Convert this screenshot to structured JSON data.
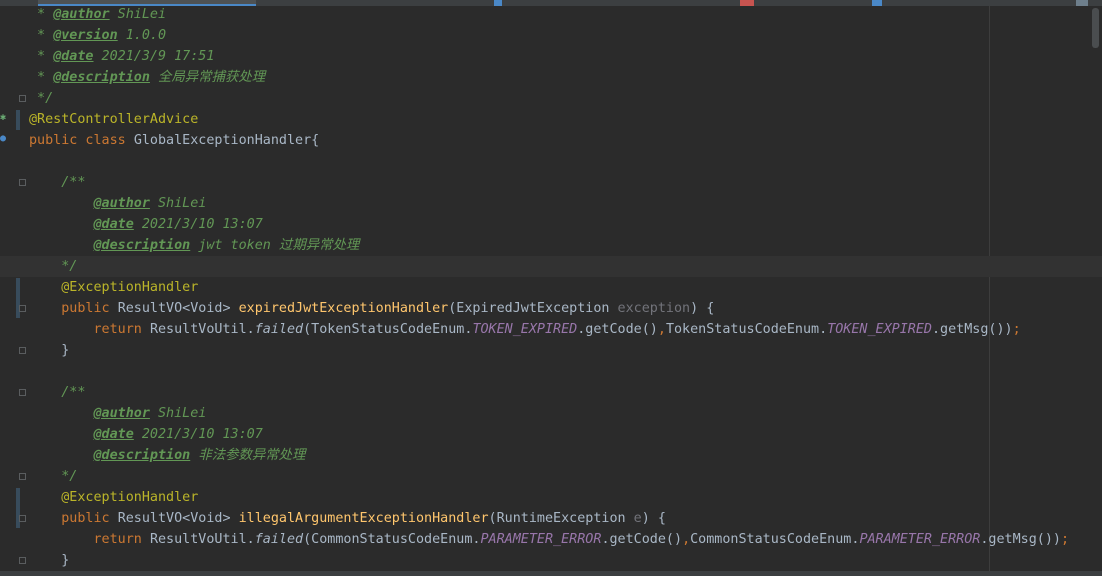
{
  "editor": {
    "colors": {
      "background": "#2b2b2b",
      "doc_comment": "#629755",
      "annotation": "#bbb529",
      "keyword": "#cc7832",
      "method": "#ffc66d",
      "constant": "#9876aa",
      "default_text": "#a9b7c6",
      "unused_param": "#72737a"
    },
    "lines": [
      {
        "t": [
          [
            "doc",
            " * "
          ],
          [
            "tag",
            "@author"
          ],
          [
            "doc",
            " ShiLei"
          ]
        ]
      },
      {
        "t": [
          [
            "doc",
            " * "
          ],
          [
            "tag",
            "@version"
          ],
          [
            "doc",
            " 1.0.0"
          ]
        ]
      },
      {
        "t": [
          [
            "doc",
            " * "
          ],
          [
            "tag",
            "@date"
          ],
          [
            "doc",
            " 2021/3/9 17:51"
          ]
        ]
      },
      {
        "t": [
          [
            "doc",
            " * "
          ],
          [
            "tag",
            "@description"
          ],
          [
            "doc",
            " 全局异常捕获处理"
          ]
        ]
      },
      {
        "t": [
          [
            "doc",
            " */"
          ]
        ]
      },
      {
        "t": [
          [
            "ann",
            "@RestControllerAdvice"
          ]
        ]
      },
      {
        "t": [
          [
            "kw",
            "public class "
          ],
          [
            "ident",
            "GlobalExceptionHandler{"
          ]
        ]
      },
      {
        "t": []
      },
      {
        "t": [
          [
            "doc",
            "    /**"
          ]
        ]
      },
      {
        "t": [
          [
            "doc",
            "        "
          ],
          [
            "tag",
            "@author"
          ],
          [
            "doc",
            " ShiLei"
          ]
        ]
      },
      {
        "t": [
          [
            "doc",
            "        "
          ],
          [
            "tag",
            "@date"
          ],
          [
            "doc",
            " 2021/3/10 13:07"
          ]
        ]
      },
      {
        "t": [
          [
            "doc",
            "        "
          ],
          [
            "tag",
            "@description"
          ],
          [
            "doc",
            " jwt token 过期异常处理"
          ]
        ]
      },
      {
        "t": [
          [
            "doc",
            "    */"
          ]
        ],
        "current": true
      },
      {
        "t": [
          [
            "ann",
            "    @ExceptionHandler"
          ]
        ]
      },
      {
        "t": [
          [
            "kw",
            "    public "
          ],
          [
            "ident",
            "ResultVO<Void> "
          ],
          [
            "fn",
            "expiredJwtExceptionHandler"
          ],
          [
            "ident",
            "(ExpiredJwtException "
          ],
          [
            "param",
            "exception"
          ],
          [
            "ident",
            ") {"
          ]
        ]
      },
      {
        "t": [
          [
            "kw",
            "        return "
          ],
          [
            "ident",
            "ResultVoUtil."
          ],
          [
            "statcall",
            "failed"
          ],
          [
            "ident",
            "(TokenStatusCodeEnum."
          ],
          [
            "static",
            "TOKEN_EXPIRED"
          ],
          [
            "ident",
            ".getCode()"
          ],
          [
            "punct",
            ","
          ],
          [
            "ident",
            "TokenStatusCodeEnum."
          ],
          [
            "static",
            "TOKEN_EXPIRED"
          ],
          [
            "ident",
            ".getMsg())"
          ],
          [
            "punct",
            ";"
          ]
        ]
      },
      {
        "t": [
          [
            "ident",
            "    }"
          ]
        ]
      },
      {
        "t": []
      },
      {
        "t": [
          [
            "doc",
            "    /**"
          ]
        ]
      },
      {
        "t": [
          [
            "doc",
            "        "
          ],
          [
            "tag",
            "@author"
          ],
          [
            "doc",
            " ShiLei"
          ]
        ]
      },
      {
        "t": [
          [
            "doc",
            "        "
          ],
          [
            "tag",
            "@date"
          ],
          [
            "doc",
            " 2021/3/10 13:07"
          ]
        ]
      },
      {
        "t": [
          [
            "doc",
            "        "
          ],
          [
            "tag",
            "@description"
          ],
          [
            "doc",
            " 非法参数异常处理"
          ]
        ]
      },
      {
        "t": [
          [
            "doc",
            "    */"
          ]
        ]
      },
      {
        "t": [
          [
            "ann",
            "    @ExceptionHandler"
          ]
        ]
      },
      {
        "t": [
          [
            "kw",
            "    public "
          ],
          [
            "ident",
            "ResultVO<Void> "
          ],
          [
            "fn",
            "illegalArgumentExceptionHandler"
          ],
          [
            "ident",
            "(RuntimeException "
          ],
          [
            "param",
            "e"
          ],
          [
            "ident",
            ") {"
          ]
        ]
      },
      {
        "t": [
          [
            "kw",
            "        return "
          ],
          [
            "ident",
            "ResultVoUtil."
          ],
          [
            "statcall",
            "failed"
          ],
          [
            "ident",
            "(CommonStatusCodeEnum."
          ],
          [
            "static",
            "PARAMETER_ERROR"
          ],
          [
            "ident",
            ".getCode()"
          ],
          [
            "punct",
            ","
          ],
          [
            "ident",
            "CommonStatusCodeEnum."
          ],
          [
            "static",
            "PARAMETER_ERROR"
          ],
          [
            "ident",
            ".getMsg())"
          ],
          [
            "punct",
            ";"
          ]
        ]
      },
      {
        "t": [
          [
            "ident",
            "    }"
          ]
        ]
      }
    ]
  }
}
